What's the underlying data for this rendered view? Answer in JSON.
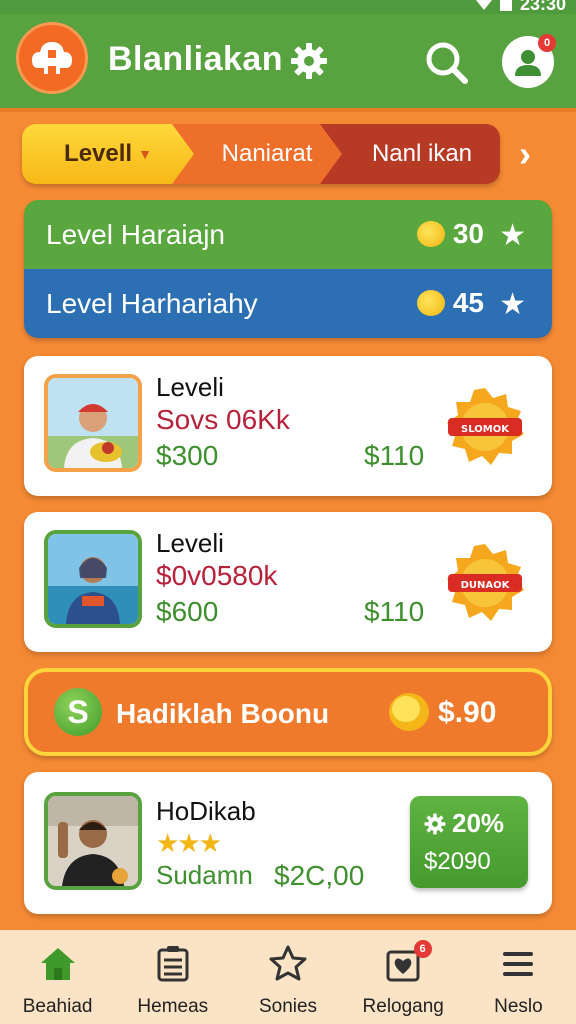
{
  "status": {
    "time": "23:30"
  },
  "header": {
    "title": "Blanliakan",
    "profile_badge": "0"
  },
  "tabs": [
    {
      "label": "Levell"
    },
    {
      "label": "Naniarat"
    },
    {
      "label": "Nanl ikan"
    }
  ],
  "levels": [
    {
      "label": "Level Haraiajn",
      "value": "30"
    },
    {
      "label": "Level Harhariahy",
      "value": "45"
    }
  ],
  "deals": [
    {
      "name": "Leveli",
      "code": "Sovs 06Kk",
      "price_a": "$300",
      "price_b": "$110",
      "badge": "SLOMOK"
    },
    {
      "name": "Leveli",
      "code": "$0v0580k",
      "price_a": "$600",
      "price_b": "$110",
      "badge": "DUNAOK"
    }
  ],
  "bonus": {
    "icon_letter": "S",
    "label": "Hadiklah Boonu",
    "value": "$.90"
  },
  "reward": {
    "name": "HoDikab",
    "stars": "★★★",
    "sub": "Sudamn",
    "amount": "$2C,00",
    "discount": "20%",
    "discount_amount": "$2090"
  },
  "nav": [
    {
      "label": "Beahiad",
      "icon": "home-icon"
    },
    {
      "label": "Hemeas",
      "icon": "list-icon"
    },
    {
      "label": "Sonies",
      "icon": "star-house-icon"
    },
    {
      "label": "Relogang",
      "icon": "heart-box-icon",
      "badge": "6"
    },
    {
      "label": "Neslo",
      "icon": "menu-icon"
    }
  ],
  "colors": {
    "header_green": "#58a23f",
    "background_orange": "#f58a34",
    "level_blue": "#2c6fb2",
    "price_green": "#3e8f2e",
    "code_red": "#b8213a"
  }
}
